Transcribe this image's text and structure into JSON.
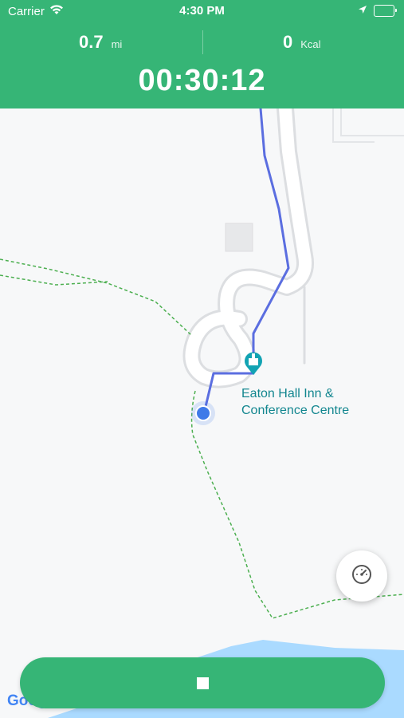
{
  "status_bar": {
    "carrier": "Carrier",
    "time": "4:30 PM"
  },
  "stats": {
    "distance_value": "0.7",
    "distance_unit": "mi",
    "calories_value": "0",
    "calories_unit": "Kcal"
  },
  "timer": "00:30:12",
  "map": {
    "poi_name_line1": "Eaton Hall Inn &",
    "poi_name_line2": "Conference Centre",
    "attribution": "Google"
  },
  "colors": {
    "brand_green": "#36b576",
    "route_blue": "#5b6ee0",
    "trail_green": "#4caf50",
    "poi_teal": "#12a3b3",
    "water": "#aadaff"
  },
  "icons": {
    "speedometer": "speedometer-icon",
    "stop": "stop-icon"
  }
}
